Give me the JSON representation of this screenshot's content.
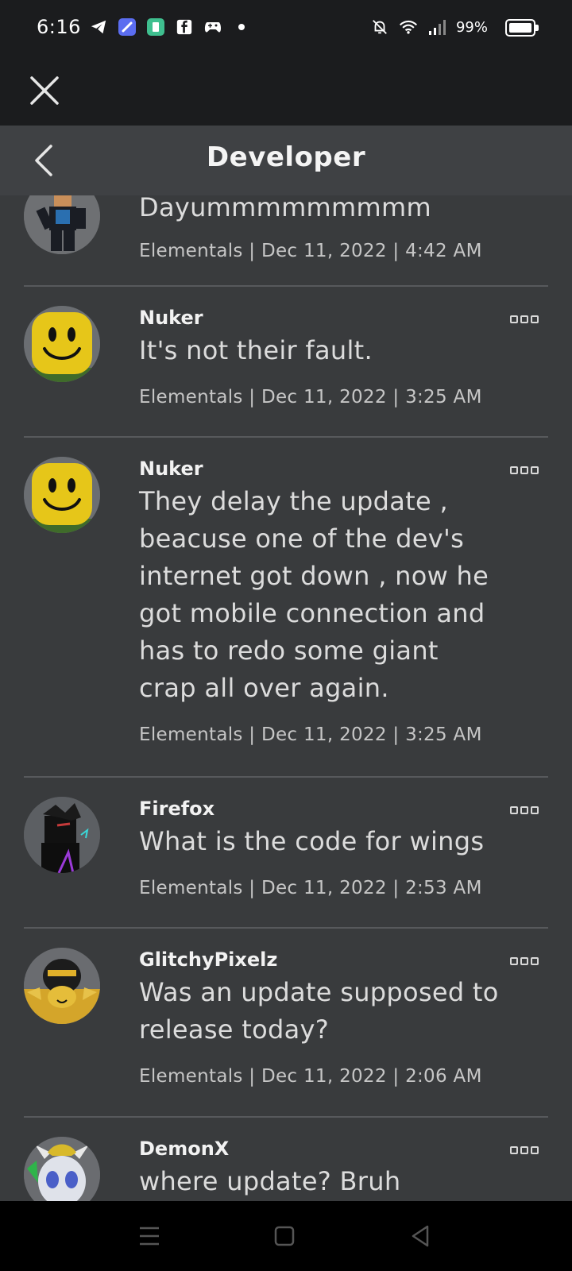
{
  "status_bar": {
    "time": "6:16",
    "battery_text": "99%",
    "left_icons": [
      "telegram-icon",
      "app-icon-blue",
      "app-icon-green",
      "facebook-icon",
      "gamepad-icon",
      "dot-icon"
    ],
    "right_icons": [
      "bell-off-icon",
      "wifi-icon",
      "signal-icon",
      "battery-icon"
    ]
  },
  "header": {
    "title": "Developer"
  },
  "posts": [
    {
      "author": "",
      "message": "Dayummmmmmmmm",
      "meta": "Elementals | Dec 11, 2022 | 4:42 AM",
      "avatar": "avatar-blocky"
    },
    {
      "author": "Nuker",
      "message": "It's not their fault.",
      "meta": "Elementals | Dec 11, 2022 | 3:25 AM",
      "avatar": "avatar-smiley"
    },
    {
      "author": "Nuker",
      "message": "They delay the update , beacuse one of the dev's internet got down , now he got mobile connection and has to redo some giant crap all over again.",
      "meta": "Elementals | Dec 11, 2022 | 3:25 AM",
      "avatar": "avatar-smiley"
    },
    {
      "author": "Firefox",
      "message": "What is the code for wings",
      "meta": "Elementals | Dec 11, 2022 | 2:53 AM",
      "avatar": "avatar-dark"
    },
    {
      "author": "GlitchyPixelz",
      "message": "Was an update supposed to release today?",
      "meta": "Elementals | Dec 11, 2022 | 2:06 AM",
      "avatar": "avatar-yellow"
    },
    {
      "author": "DemonX",
      "message": "where update? Bruh",
      "meta": "",
      "avatar": "avatar-demon"
    }
  ],
  "colors": {
    "background": "#393b3d",
    "header": "#3f4144",
    "topbar": "#1b1c1e"
  }
}
